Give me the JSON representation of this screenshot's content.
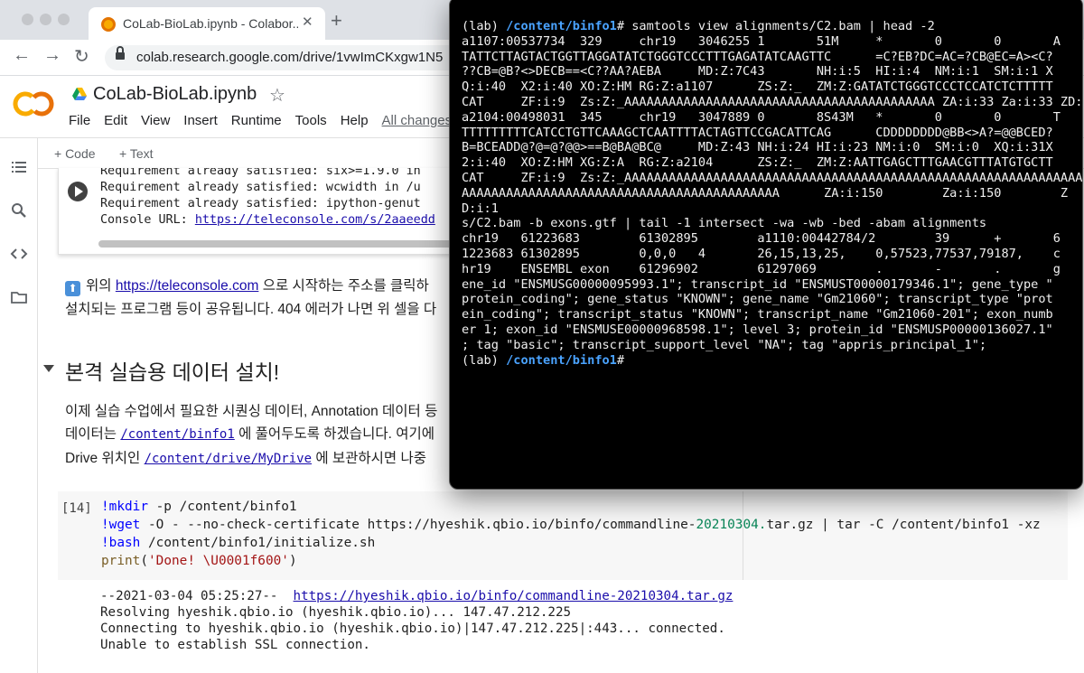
{
  "browser": {
    "tab_title": "CoLab-BioLab.ipynb - Colabor...",
    "tab_close": "✕",
    "new_tab": "+",
    "back": "←",
    "forward": "→",
    "reload": "↻",
    "url": "colab.research.google.com/drive/1vwImCKxgw1N5"
  },
  "colab": {
    "logo": "CO",
    "doc_title": "CoLab-BioLab.ipynb",
    "star": "☆",
    "menu": [
      "File",
      "Edit",
      "View",
      "Insert",
      "Runtime",
      "Tools",
      "Help"
    ],
    "changes_label": "All changes",
    "toolbar": {
      "add_code": "+ Code",
      "add_text": "+ Text"
    }
  },
  "output_block": {
    "lines": [
      "Requirement already satisfied: six>=1.9.0 in",
      "Requirement already satisfied: wcwidth in /u",
      "Requirement already satisfied: ipython-genut",
      "Console URL: "
    ],
    "console_url": "https://teleconsole.com/s/2aaeedd"
  },
  "text": {
    "para1_prefix": "위의",
    "para1_link": "https://teleconsole.com",
    "para1_suffix": "으로 시작하는 주소를 클릭하",
    "para1_line2": "설치되는 프로그램 등이 공유됩니다. 404 에러가 나면 위 셀을 다",
    "heading": "본격 실습용 데이터 설치!",
    "para2_line1": "이제 실습 수업에서 필요한 시퀀싱 데이터, Annotation 데이터 등",
    "para2_line2_prefix": "데이터는",
    "para2_line2_code": "/content/binfo1",
    "para2_line2_suffix": "에 풀어두도록 하겠습니다. 여기에",
    "para2_line3_prefix": "Drive 위치인",
    "para2_line3_code": "/content/drive/MyDrive",
    "para2_line3_suffix": "에 보관하시면 나중"
  },
  "code_cell": {
    "exec_count": "[14]",
    "line1_cmd": "!mkdir",
    "line1_rest": " -p /content/binfo1",
    "line2_cmd": "!wget",
    "line2_a": " -O - --no-check-certificate https://hyeshik.qbio.io/binfo/commandline-",
    "line2_num": "20210304.",
    "line2_b": "tar.gz | tar -C /content/binfo1 -xz",
    "line3_cmd": "!bash",
    "line3_rest": " /content/binfo1/initialize.sh",
    "line4_fn": "print",
    "line4_p1": "(",
    "line4_str": "'Done! \\U0001f600'",
    "line4_p2": ")"
  },
  "cell_output": {
    "wget_prefix": "--2021-03-04 05:25:27--  ",
    "wget_url": "https://hyeshik.qbio.io/binfo/commandline-20210304.tar.gz",
    "lines": [
      "Resolving hyeshik.qbio.io (hyeshik.qbio.io)... 147.47.212.225",
      "Connecting to hyeshik.qbio.io (hyeshik.qbio.io)|147.47.212.225|:443... connected.",
      "Unable to establish SSL connection."
    ]
  },
  "terminal": {
    "env": "(lab) ",
    "cwd": "/content/binfo1",
    "cmd1": "# samtools view alignments/C2.bam | head -2",
    "body": [
      "a1107:00537734  329     chr19   3046255 1       51M     *       0       0       A",
      "TATTCTTAGTACTGGTTAGGATATCTGGGTCCCTTTGAGATATCAAGTTC      =C?EB?DC=AC=?CB@EC=A><C?",
      "??CB=@B?<>DECB==<C??AA?AEBA     MD:Z:7C43       NH:i:5  HI:i:4  NM:i:1  SM:i:1 X",
      "Q:i:40  X2:i:40 XO:Z:HM RG:Z:a1107      ZS:Z:_  ZM:Z:GATATCTGGGTCCCTCCATCTCTTTTT",
      "CAT     ZF:i:9  Zs:Z:_AAAAAAAAAAAAAAAAAAAAAAAAAAAAAAAAAAAAAAAAAA ZA:i:33 Za:i:33 ZD:i:1",
      "a2104:00498031  345     chr19   3047889 0       8S43M   *       0       0       T",
      "TTTTTTTTTCATCCTGTTCAAAGCTCAATTTTACTAGTTCCGACATTCAG      CDDDDDDDD@BB<>A?=@@BCED?",
      "B=BCEADD@?@=@?@@>==B@BA@BC@     MD:Z:43 NH:i:24 HI:i:23 NM:i:0  SM:i:0  XQ:i:31X",
      "2:i:40  XO:Z:HM XG:Z:A  RG:Z:a2104      ZS:Z:_  ZM:Z:AATTGAGCTTTGAACGTTTATGTGCTT",
      "CAT     ZF:i:9  Zs:Z:_AAAAAAAAAAAAAAAAAAAAAAAAAAAAAAAAAAAAAAAAAAAAAAAAAAAAAAAAAAAAAA",
      "AAAAAAAAAAAAAAAAAAAAAAAAAAAAAAAAAAAAAAAAAAA      ZA:i:150        Za:i:150        Z",
      "D:i:1",
      "s/C2.bam -b exons.gtf | tail -1 intersect -wa -wb -bed -abam alignments",
      "chr19   61223683        61302895        a1110:00442784/2        39      +       6",
      "1223683 61302895        0,0,0   4       26,15,13,25,    0,57523,77537,79187,    c",
      "hr19    ENSEMBL exon    61296902        61297069        .       -       .       g",
      "ene_id \"ENSMUSG00000095993.1\"; transcript_id \"ENSMUST00000179346.1\"; gene_type \"",
      "protein_coding\"; gene_status \"KNOWN\"; gene_name \"Gm21060\"; transcript_type \"prot",
      "ein_coding\"; transcript_status \"KNOWN\"; transcript_name \"Gm21060-201\"; exon_numb",
      "er 1; exon_id \"ENSMUSE00000968598.1\"; level 3; protein_id \"ENSMUSP00000136027.1\"",
      "; tag \"basic\"; transcript_support_level \"NA\"; tag \"appris_principal_1\";"
    ],
    "final_prompt": "#"
  },
  "colors": {
    "terminal_bg": "#000000",
    "prompt_dir": "#4aa3ff",
    "colab_orange": "#f9ab00",
    "link": "#1a0dab"
  }
}
